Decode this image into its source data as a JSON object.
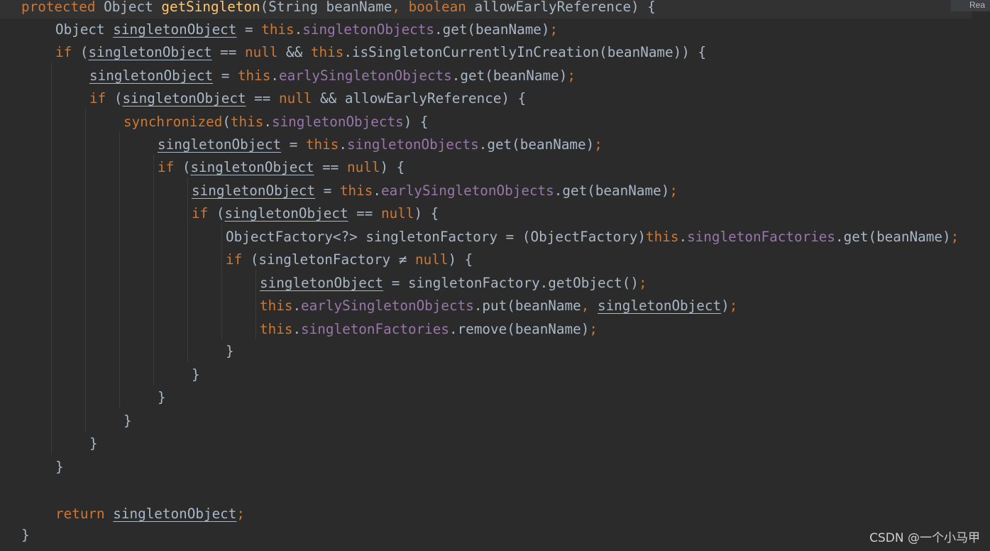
{
  "editor": {
    "lines": [
      [
        [
          "kw",
          "protected "
        ],
        [
          "pl",
          "Object "
        ],
        [
          "fn",
          "getSingleton"
        ],
        [
          "pl",
          "(String beanName"
        ],
        [
          "pu",
          ", "
        ],
        [
          "kw",
          "boolean "
        ],
        [
          "pl",
          "allowEarlyReference) {"
        ]
      ],
      [
        [
          "pl",
          "Object "
        ],
        [
          "var",
          "singletonObject"
        ],
        [
          "pl",
          " = "
        ],
        [
          "kw",
          "this"
        ],
        [
          "pl",
          "."
        ],
        [
          "field",
          "singletonObjects"
        ],
        [
          "pl",
          ".get(beanName)"
        ],
        [
          "pu",
          ";"
        ]
      ],
      [
        [
          "kw",
          "if "
        ],
        [
          "pl",
          "("
        ],
        [
          "var",
          "singletonObject"
        ],
        [
          "pl",
          " == "
        ],
        [
          "kw",
          "null "
        ],
        [
          "pl",
          "&& "
        ],
        [
          "kw",
          "this"
        ],
        [
          "pl",
          ".isSingletonCurrentlyInCreation(beanName)) {"
        ]
      ],
      [
        [
          "var",
          "singletonObject"
        ],
        [
          "pl",
          " = "
        ],
        [
          "kw",
          "this"
        ],
        [
          "pl",
          "."
        ],
        [
          "field",
          "earlySingletonObjects"
        ],
        [
          "pl",
          ".get(beanName)"
        ],
        [
          "pu",
          ";"
        ]
      ],
      [
        [
          "kw",
          "if "
        ],
        [
          "pl",
          "("
        ],
        [
          "var",
          "singletonObject"
        ],
        [
          "pl",
          " == "
        ],
        [
          "kw",
          "null "
        ],
        [
          "pl",
          "&& allowEarlyReference) {"
        ]
      ],
      [
        [
          "kw",
          "synchronized"
        ],
        [
          "pl",
          "("
        ],
        [
          "kw",
          "this"
        ],
        [
          "pl",
          "."
        ],
        [
          "field",
          "singletonObjects"
        ],
        [
          "pl",
          ") {"
        ]
      ],
      [
        [
          "var",
          "singletonObject"
        ],
        [
          "pl",
          " = "
        ],
        [
          "kw",
          "this"
        ],
        [
          "pl",
          "."
        ],
        [
          "field",
          "singletonObjects"
        ],
        [
          "pl",
          ".get(beanName)"
        ],
        [
          "pu",
          ";"
        ]
      ],
      [
        [
          "kw",
          "if "
        ],
        [
          "pl",
          "("
        ],
        [
          "var",
          "singletonObject"
        ],
        [
          "pl",
          " == "
        ],
        [
          "kw",
          "null"
        ],
        [
          "pl",
          ") {"
        ]
      ],
      [
        [
          "var",
          "singletonObject"
        ],
        [
          "pl",
          " = "
        ],
        [
          "kw",
          "this"
        ],
        [
          "pl",
          "."
        ],
        [
          "field",
          "earlySingletonObjects"
        ],
        [
          "pl",
          ".get(beanName)"
        ],
        [
          "pu",
          ";"
        ]
      ],
      [
        [
          "kw",
          "if "
        ],
        [
          "pl",
          "("
        ],
        [
          "var",
          "singletonObject"
        ],
        [
          "pl",
          " == "
        ],
        [
          "kw",
          "null"
        ],
        [
          "pl",
          ") {"
        ]
      ],
      [
        [
          "pl",
          "ObjectFactory<?> singletonFactory = (ObjectFactory)"
        ],
        [
          "kw",
          "this"
        ],
        [
          "pl",
          "."
        ],
        [
          "field",
          "singletonFactories"
        ],
        [
          "pl",
          ".get(beanName)"
        ],
        [
          "pu",
          ";"
        ]
      ],
      [
        [
          "kw",
          "if "
        ],
        [
          "pl",
          "(singletonFactory ≠ "
        ],
        [
          "kw",
          "null"
        ],
        [
          "pl",
          ") {"
        ]
      ],
      [
        [
          "var",
          "singletonObject"
        ],
        [
          "pl",
          " = singletonFactory.getObject()"
        ],
        [
          "pu",
          ";"
        ]
      ],
      [
        [
          "kw",
          "this"
        ],
        [
          "pl",
          "."
        ],
        [
          "field",
          "earlySingletonObjects"
        ],
        [
          "pl",
          ".put(beanName"
        ],
        [
          "pu",
          ", "
        ],
        [
          "var",
          "singletonObject"
        ],
        [
          "pl",
          ")"
        ],
        [
          "pu",
          ";"
        ]
      ],
      [
        [
          "kw",
          "this"
        ],
        [
          "pl",
          "."
        ],
        [
          "field",
          "singletonFactories"
        ],
        [
          "pl",
          ".remove(beanName)"
        ],
        [
          "pu",
          ";"
        ]
      ],
      [
        [
          "pl",
          "}"
        ]
      ],
      [
        [
          "pl",
          "}"
        ]
      ],
      [
        [
          "pl",
          "}"
        ]
      ],
      [
        [
          "pl",
          "}"
        ]
      ],
      [
        [
          "pl",
          "}"
        ]
      ],
      [
        [
          "pl",
          "}"
        ]
      ],
      [],
      [
        [
          "kw",
          "return "
        ],
        [
          "var",
          "singletonObject"
        ],
        [
          "pu",
          ";"
        ]
      ],
      [
        [
          "pl",
          "}"
        ]
      ]
    ]
  },
  "reader_mode_label": "Rea",
  "watermark": "CSDN @一个小马甲"
}
